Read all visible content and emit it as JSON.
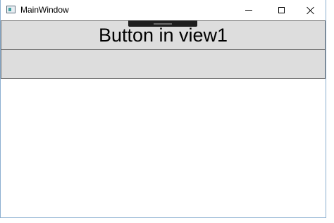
{
  "window": {
    "title": "MainWindow",
    "icon": "wpf-app-icon",
    "caption_buttons": [
      "minimize-icon",
      "maximize-icon",
      "close-icon"
    ]
  },
  "content": {
    "button1_label": "Button in view1",
    "button2_label": ""
  },
  "colors": {
    "button_background": "#dddddd",
    "button_border": "#707070",
    "window_border": "#8aaed0",
    "debug_toolbar": "#1e1e1e"
  }
}
